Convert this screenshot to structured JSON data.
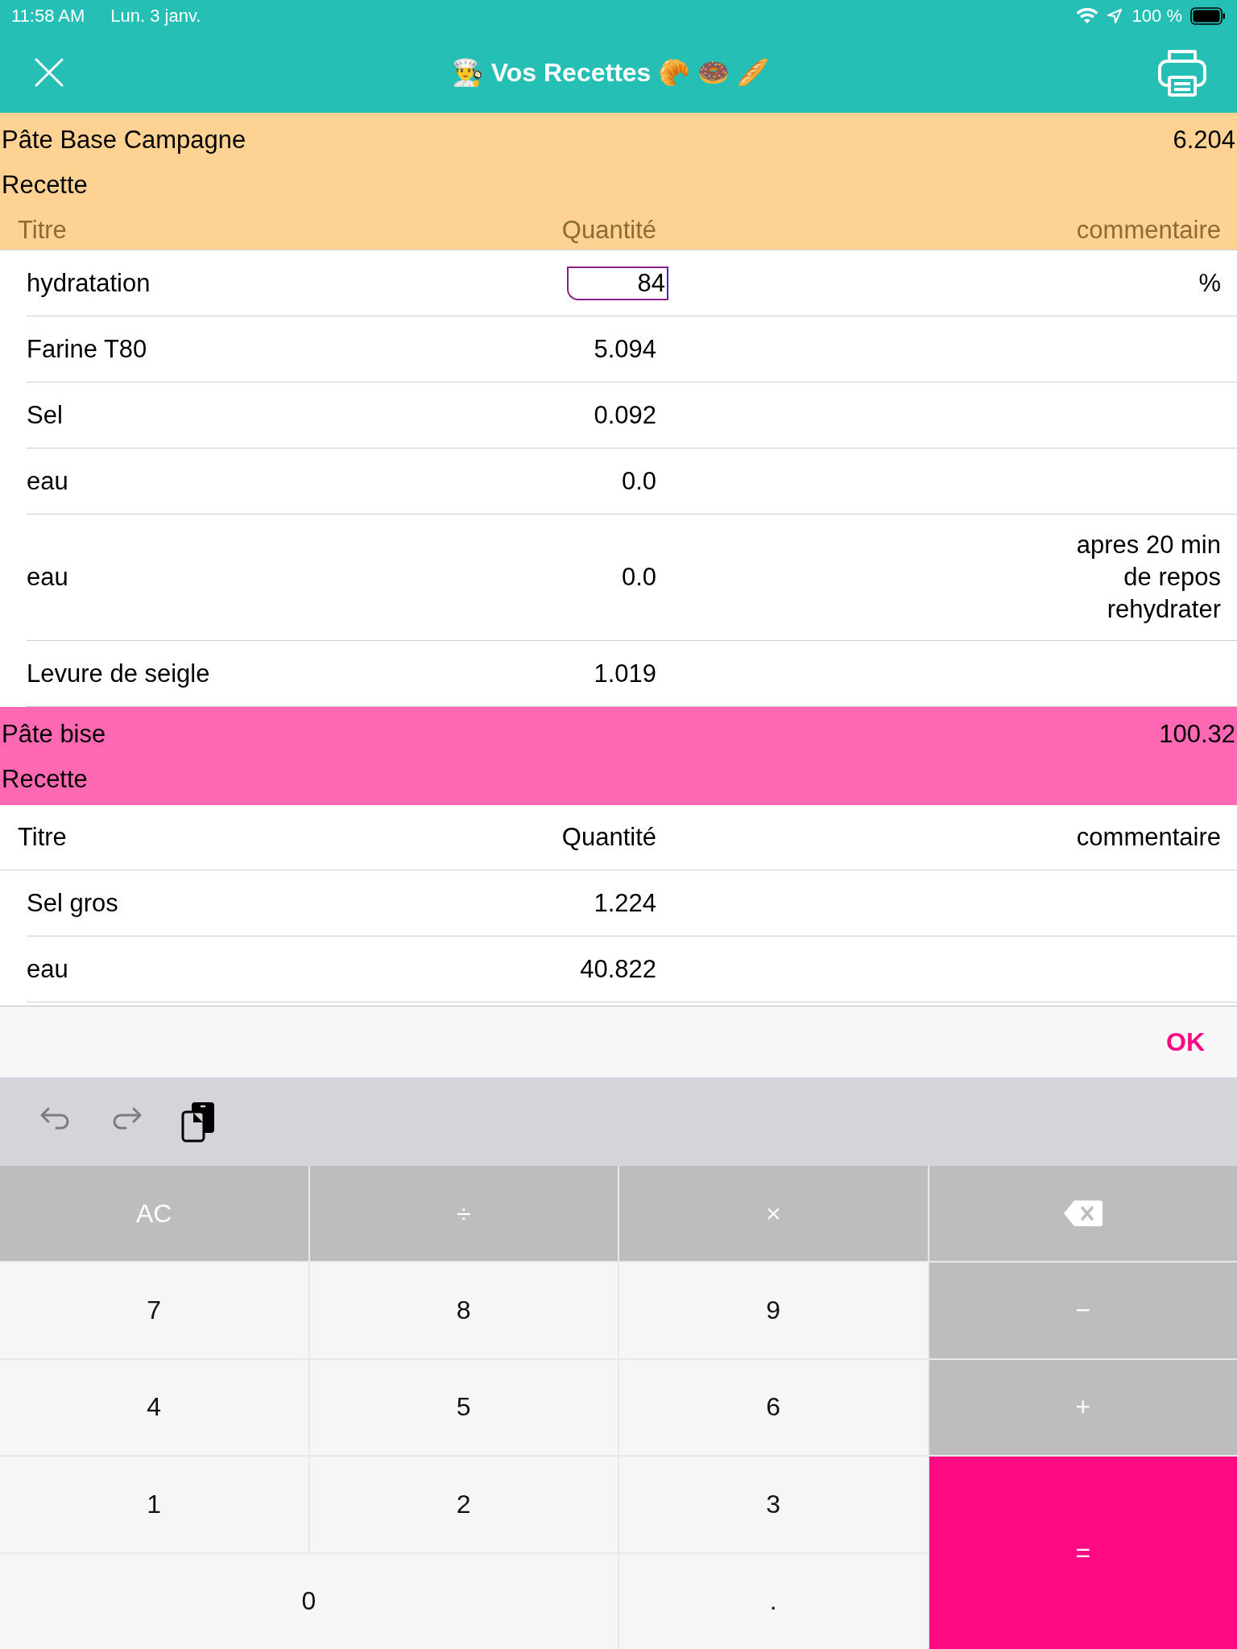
{
  "status_bar": {
    "time": "11:58 AM",
    "date": "Lun. 3 janv.",
    "battery": "100 %"
  },
  "nav": {
    "title": "👨‍🍳 Vos Recettes 🥐 🍩 🥖"
  },
  "sections": [
    {
      "name": "Pâte Base Campagne",
      "total": "6.204",
      "subtitle": "Recette",
      "color": "#fdd293",
      "columns": [
        "Titre",
        "Quantité",
        "commentaire"
      ],
      "rows": [
        {
          "title": "hydratation",
          "quantity": "84",
          "kind": "input",
          "comment": "%"
        },
        {
          "title": "Farine T80",
          "quantity": "5.094",
          "kind": "text"
        },
        {
          "title": "Sel",
          "quantity": "0.092",
          "kind": "text"
        },
        {
          "title": "eau",
          "quantity": "0.0",
          "kind": "text"
        },
        {
          "title": "eau",
          "quantity": "0.0",
          "kind": "text",
          "comment": "apres 20 min de repos rehydrater"
        },
        {
          "title": "Levure de seigle",
          "quantity": "1.019",
          "kind": "text"
        }
      ]
    },
    {
      "name": "Pâte bise",
      "total": "100.32",
      "subtitle": "Recette",
      "color": "#ff69b4",
      "columns": [
        "Titre",
        "Quantité",
        "commentaire"
      ],
      "rows": [
        {
          "title": "Sel gros",
          "quantity": "1.224",
          "kind": "text"
        },
        {
          "title": "eau",
          "quantity": "40.822",
          "kind": "text"
        }
      ]
    }
  ],
  "accessory": {
    "done": "OK"
  },
  "keys": [
    {
      "label": "AC",
      "kind": "op"
    },
    {
      "label": "÷",
      "kind": "op"
    },
    {
      "label": "×",
      "kind": "op"
    },
    {
      "kind": "backspace"
    },
    {
      "label": "7",
      "kind": "digit"
    },
    {
      "label": "8",
      "kind": "digit"
    },
    {
      "label": "9",
      "kind": "digit"
    },
    {
      "label": "−",
      "kind": "op"
    },
    {
      "label": "4",
      "kind": "digit"
    },
    {
      "label": "5",
      "kind": "digit"
    },
    {
      "label": "6",
      "kind": "digit"
    },
    {
      "label": "+",
      "kind": "op"
    },
    {
      "label": "1",
      "kind": "digit"
    },
    {
      "label": "2",
      "kind": "digit"
    },
    {
      "label": "3",
      "kind": "digit"
    },
    {
      "label": "=",
      "kind": "equals"
    },
    {
      "label": "0",
      "kind": "wide"
    },
    {
      "label": ".",
      "kind": "digit"
    }
  ]
}
